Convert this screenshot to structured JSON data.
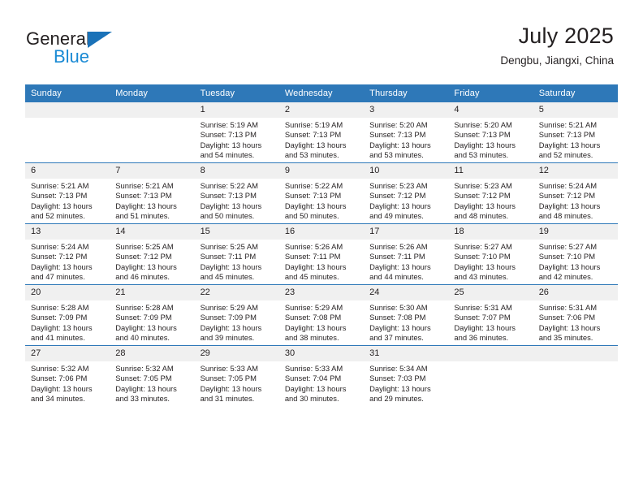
{
  "brand": {
    "name_part1": "General",
    "name_part2": "Blue",
    "triangle_color": "#1a72b8",
    "blue_text_color": "#1a8ad4"
  },
  "header": {
    "title": "July 2025",
    "subtitle": "Dengbu, Jiangxi, China",
    "accent_color": "#2e78b8"
  },
  "weekday_headers": [
    "Sunday",
    "Monday",
    "Tuesday",
    "Wednesday",
    "Thursday",
    "Friday",
    "Saturday"
  ],
  "labels": {
    "sunrise": "Sunrise:",
    "sunset": "Sunset:",
    "daylight": "Daylight:"
  },
  "weeks": [
    [
      {
        "day": "",
        "sunrise": "",
        "sunset": "",
        "daylight_line1": "",
        "daylight_line2": "",
        "empty": true
      },
      {
        "day": "",
        "sunrise": "",
        "sunset": "",
        "daylight_line1": "",
        "daylight_line2": "",
        "empty": true
      },
      {
        "day": "1",
        "sunrise": "Sunrise: 5:19 AM",
        "sunset": "Sunset: 7:13 PM",
        "daylight_line1": "Daylight: 13 hours",
        "daylight_line2": "and 54 minutes."
      },
      {
        "day": "2",
        "sunrise": "Sunrise: 5:19 AM",
        "sunset": "Sunset: 7:13 PM",
        "daylight_line1": "Daylight: 13 hours",
        "daylight_line2": "and 53 minutes."
      },
      {
        "day": "3",
        "sunrise": "Sunrise: 5:20 AM",
        "sunset": "Sunset: 7:13 PM",
        "daylight_line1": "Daylight: 13 hours",
        "daylight_line2": "and 53 minutes."
      },
      {
        "day": "4",
        "sunrise": "Sunrise: 5:20 AM",
        "sunset": "Sunset: 7:13 PM",
        "daylight_line1": "Daylight: 13 hours",
        "daylight_line2": "and 53 minutes."
      },
      {
        "day": "5",
        "sunrise": "Sunrise: 5:21 AM",
        "sunset": "Sunset: 7:13 PM",
        "daylight_line1": "Daylight: 13 hours",
        "daylight_line2": "and 52 minutes."
      }
    ],
    [
      {
        "day": "6",
        "sunrise": "Sunrise: 5:21 AM",
        "sunset": "Sunset: 7:13 PM",
        "daylight_line1": "Daylight: 13 hours",
        "daylight_line2": "and 52 minutes."
      },
      {
        "day": "7",
        "sunrise": "Sunrise: 5:21 AM",
        "sunset": "Sunset: 7:13 PM",
        "daylight_line1": "Daylight: 13 hours",
        "daylight_line2": "and 51 minutes."
      },
      {
        "day": "8",
        "sunrise": "Sunrise: 5:22 AM",
        "sunset": "Sunset: 7:13 PM",
        "daylight_line1": "Daylight: 13 hours",
        "daylight_line2": "and 50 minutes."
      },
      {
        "day": "9",
        "sunrise": "Sunrise: 5:22 AM",
        "sunset": "Sunset: 7:13 PM",
        "daylight_line1": "Daylight: 13 hours",
        "daylight_line2": "and 50 minutes."
      },
      {
        "day": "10",
        "sunrise": "Sunrise: 5:23 AM",
        "sunset": "Sunset: 7:12 PM",
        "daylight_line1": "Daylight: 13 hours",
        "daylight_line2": "and 49 minutes."
      },
      {
        "day": "11",
        "sunrise": "Sunrise: 5:23 AM",
        "sunset": "Sunset: 7:12 PM",
        "daylight_line1": "Daylight: 13 hours",
        "daylight_line2": "and 48 minutes."
      },
      {
        "day": "12",
        "sunrise": "Sunrise: 5:24 AM",
        "sunset": "Sunset: 7:12 PM",
        "daylight_line1": "Daylight: 13 hours",
        "daylight_line2": "and 48 minutes."
      }
    ],
    [
      {
        "day": "13",
        "sunrise": "Sunrise: 5:24 AM",
        "sunset": "Sunset: 7:12 PM",
        "daylight_line1": "Daylight: 13 hours",
        "daylight_line2": "and 47 minutes."
      },
      {
        "day": "14",
        "sunrise": "Sunrise: 5:25 AM",
        "sunset": "Sunset: 7:12 PM",
        "daylight_line1": "Daylight: 13 hours",
        "daylight_line2": "and 46 minutes."
      },
      {
        "day": "15",
        "sunrise": "Sunrise: 5:25 AM",
        "sunset": "Sunset: 7:11 PM",
        "daylight_line1": "Daylight: 13 hours",
        "daylight_line2": "and 45 minutes."
      },
      {
        "day": "16",
        "sunrise": "Sunrise: 5:26 AM",
        "sunset": "Sunset: 7:11 PM",
        "daylight_line1": "Daylight: 13 hours",
        "daylight_line2": "and 45 minutes."
      },
      {
        "day": "17",
        "sunrise": "Sunrise: 5:26 AM",
        "sunset": "Sunset: 7:11 PM",
        "daylight_line1": "Daylight: 13 hours",
        "daylight_line2": "and 44 minutes."
      },
      {
        "day": "18",
        "sunrise": "Sunrise: 5:27 AM",
        "sunset": "Sunset: 7:10 PM",
        "daylight_line1": "Daylight: 13 hours",
        "daylight_line2": "and 43 minutes."
      },
      {
        "day": "19",
        "sunrise": "Sunrise: 5:27 AM",
        "sunset": "Sunset: 7:10 PM",
        "daylight_line1": "Daylight: 13 hours",
        "daylight_line2": "and 42 minutes."
      }
    ],
    [
      {
        "day": "20",
        "sunrise": "Sunrise: 5:28 AM",
        "sunset": "Sunset: 7:09 PM",
        "daylight_line1": "Daylight: 13 hours",
        "daylight_line2": "and 41 minutes."
      },
      {
        "day": "21",
        "sunrise": "Sunrise: 5:28 AM",
        "sunset": "Sunset: 7:09 PM",
        "daylight_line1": "Daylight: 13 hours",
        "daylight_line2": "and 40 minutes."
      },
      {
        "day": "22",
        "sunrise": "Sunrise: 5:29 AM",
        "sunset": "Sunset: 7:09 PM",
        "daylight_line1": "Daylight: 13 hours",
        "daylight_line2": "and 39 minutes."
      },
      {
        "day": "23",
        "sunrise": "Sunrise: 5:29 AM",
        "sunset": "Sunset: 7:08 PM",
        "daylight_line1": "Daylight: 13 hours",
        "daylight_line2": "and 38 minutes."
      },
      {
        "day": "24",
        "sunrise": "Sunrise: 5:30 AM",
        "sunset": "Sunset: 7:08 PM",
        "daylight_line1": "Daylight: 13 hours",
        "daylight_line2": "and 37 minutes."
      },
      {
        "day": "25",
        "sunrise": "Sunrise: 5:31 AM",
        "sunset": "Sunset: 7:07 PM",
        "daylight_line1": "Daylight: 13 hours",
        "daylight_line2": "and 36 minutes."
      },
      {
        "day": "26",
        "sunrise": "Sunrise: 5:31 AM",
        "sunset": "Sunset: 7:06 PM",
        "daylight_line1": "Daylight: 13 hours",
        "daylight_line2": "and 35 minutes."
      }
    ],
    [
      {
        "day": "27",
        "sunrise": "Sunrise: 5:32 AM",
        "sunset": "Sunset: 7:06 PM",
        "daylight_line1": "Daylight: 13 hours",
        "daylight_line2": "and 34 minutes."
      },
      {
        "day": "28",
        "sunrise": "Sunrise: 5:32 AM",
        "sunset": "Sunset: 7:05 PM",
        "daylight_line1": "Daylight: 13 hours",
        "daylight_line2": "and 33 minutes."
      },
      {
        "day": "29",
        "sunrise": "Sunrise: 5:33 AM",
        "sunset": "Sunset: 7:05 PM",
        "daylight_line1": "Daylight: 13 hours",
        "daylight_line2": "and 31 minutes."
      },
      {
        "day": "30",
        "sunrise": "Sunrise: 5:33 AM",
        "sunset": "Sunset: 7:04 PM",
        "daylight_line1": "Daylight: 13 hours",
        "daylight_line2": "and 30 minutes."
      },
      {
        "day": "31",
        "sunrise": "Sunrise: 5:34 AM",
        "sunset": "Sunset: 7:03 PM",
        "daylight_line1": "Daylight: 13 hours",
        "daylight_line2": "and 29 minutes."
      },
      {
        "day": "",
        "sunrise": "",
        "sunset": "",
        "daylight_line1": "",
        "daylight_line2": "",
        "empty": true
      },
      {
        "day": "",
        "sunrise": "",
        "sunset": "",
        "daylight_line1": "",
        "daylight_line2": "",
        "empty": true
      }
    ]
  ]
}
